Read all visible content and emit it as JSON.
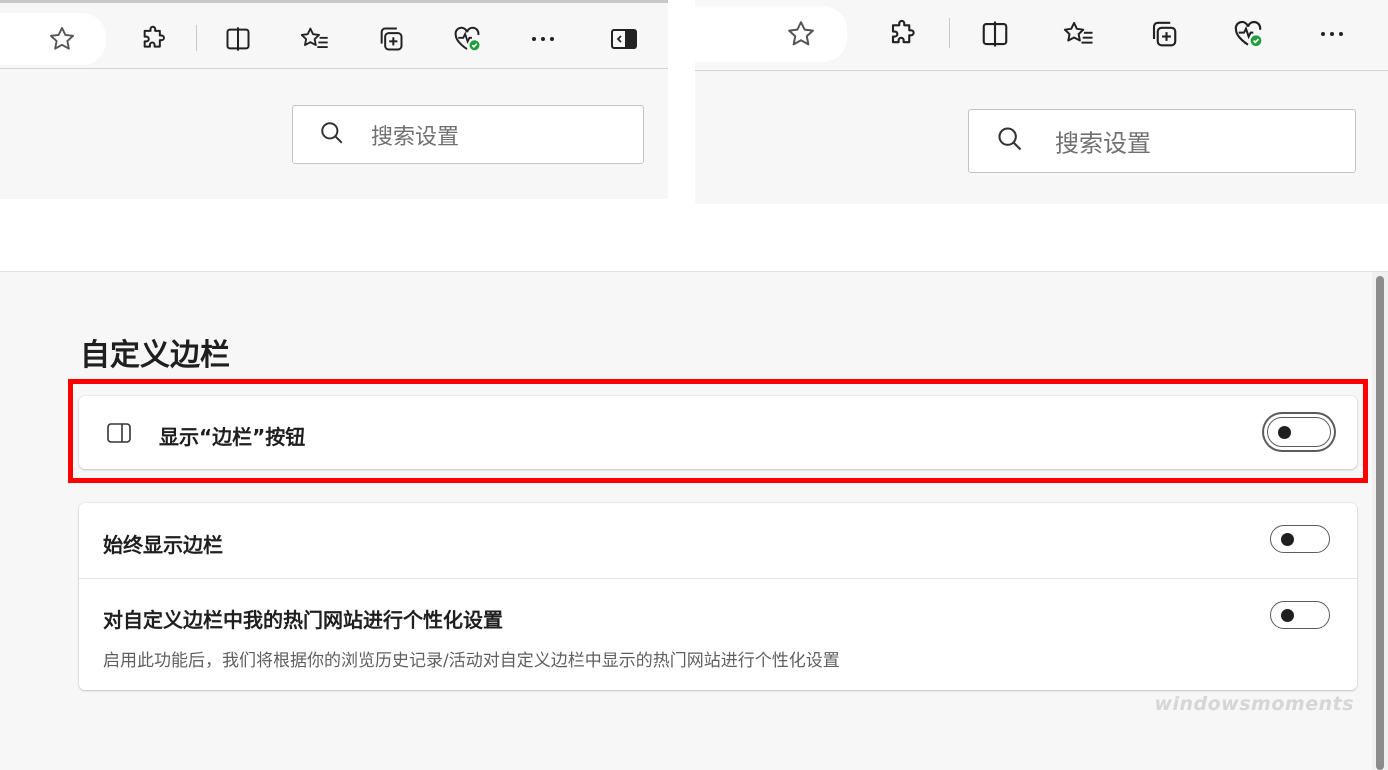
{
  "top_left": {
    "search_placeholder": "搜索设置"
  },
  "top_right": {
    "search_placeholder": "搜索设置"
  },
  "settings": {
    "section_title": "自定义边栏",
    "show_sidebar_button": {
      "label": "显示“边栏”按钮",
      "enabled": false
    },
    "always_show_sidebar": {
      "label": "始终显示边栏",
      "enabled": false
    },
    "personalize_top_sites": {
      "label": "对自定义边栏中我的热门网站进行个性化设置",
      "description": "启用此功能后，我们将根据你的浏览历史记录/活动对自定义边栏中显示的热门网站进行个性化设置",
      "enabled": false
    }
  },
  "watermark": "windowsmoments",
  "colors": {
    "highlight": "#ff0000",
    "health_badge": "#1f9d3a"
  },
  "icons": [
    "star-icon",
    "extensions-icon",
    "split-screen-icon",
    "favorites-icon",
    "collections-icon",
    "browser-essentials-icon",
    "more-icon",
    "sidebar-toggle-icon",
    "search-icon",
    "sidebar-icon"
  ]
}
